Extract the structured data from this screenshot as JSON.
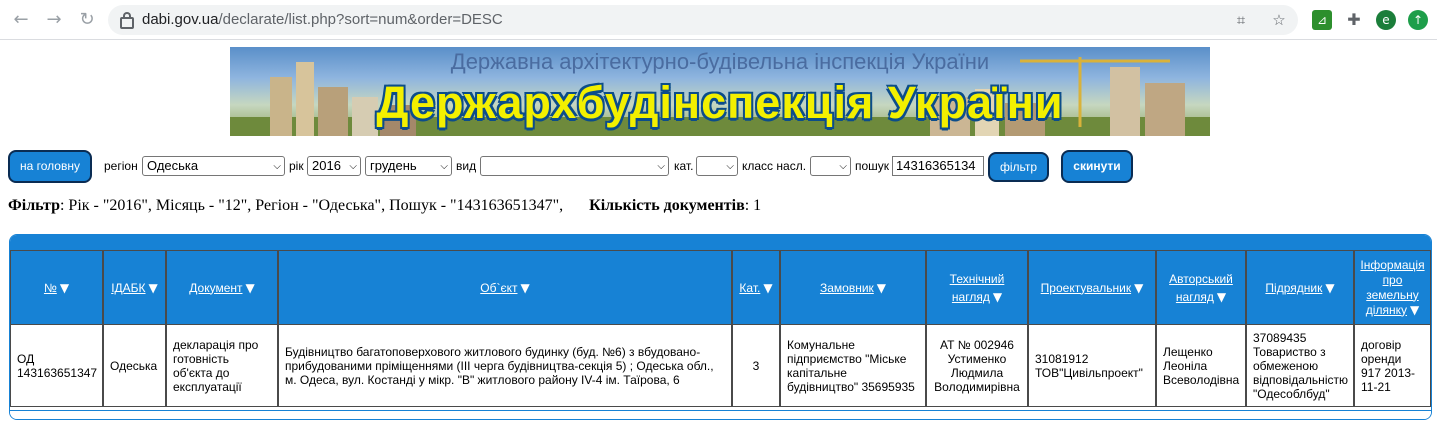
{
  "browser": {
    "url_host": "dabi.gov.ua",
    "url_path": "/declarate/list.php?sort=num&order=DESC",
    "profile_initial": "e"
  },
  "banner": {
    "subtitle": "Державна архітектурно-будівельна інспекція України",
    "title": "Держархбудінспекція України"
  },
  "filters": {
    "home_label": "на головну",
    "region_label": "регіон",
    "region_value": "Одеська",
    "year_label": "рік",
    "year_value": "2016",
    "month_value": "грудень",
    "type_label": "вид",
    "type_value": "",
    "cat_label": "кат.",
    "cat_value": "",
    "class_label": "класс насл.",
    "class_value": "",
    "search_label": "пошук",
    "search_value": "14316365134",
    "filter_button": "фільтр",
    "reset_button": "скинути"
  },
  "summary": {
    "filter_label": "Фільтр",
    "filter_text": ": Рік - \"2016\", Місяць - \"12\", Регіон - \"Одеська\", Пошук - \"143163651347\",",
    "count_label": "Кількість документів",
    "count_value": ": 1"
  },
  "table": {
    "headers": {
      "num": "№",
      "idabk": "ІДАБК",
      "document": "Документ",
      "object": "Об`єкт",
      "cat": "Кат.",
      "customer": "Замовник",
      "tech_line1": "Технічний",
      "tech_line2": "нагляд",
      "designer": "Проектувальник",
      "author_line1": "Авторський",
      "author_line2": "нагляд",
      "contractor": "Підрядник",
      "land_line1": "Інформація",
      "land_line2": "про",
      "land_line3": "земельну",
      "land_line4": "ділянку"
    },
    "row": {
      "num": "ОД 143163651347",
      "idabk": "Одеська",
      "document": "декларація про готовність об'єкта до експлуатації",
      "object": "Будівництво багатоповерхового житлового будинку (буд. №6) з вбудовано-прибудованими пріміщеннями (III черга будівництва-секція 5) ; Одеська обл., м. Одеса, вул. Костанді у мікр. \"В\" житлового району IV-4 ім. Таїрова, 6",
      "cat": "3",
      "customer": "Комунальне підприємство \"Міське капітальне будівництво\" 35695935",
      "tech": "АТ № 002946 Устименко Людмила Володимирівна",
      "designer": "31081912 ТОВ\"Цивільпроект\"",
      "author": "Лещенко Леоніла Всеволодівна",
      "contractor": "37089435 Товариство з обмеженою відповідальністю \"Одесоблбуд\"",
      "land": "договір оренди 917 2013-11-21"
    }
  }
}
